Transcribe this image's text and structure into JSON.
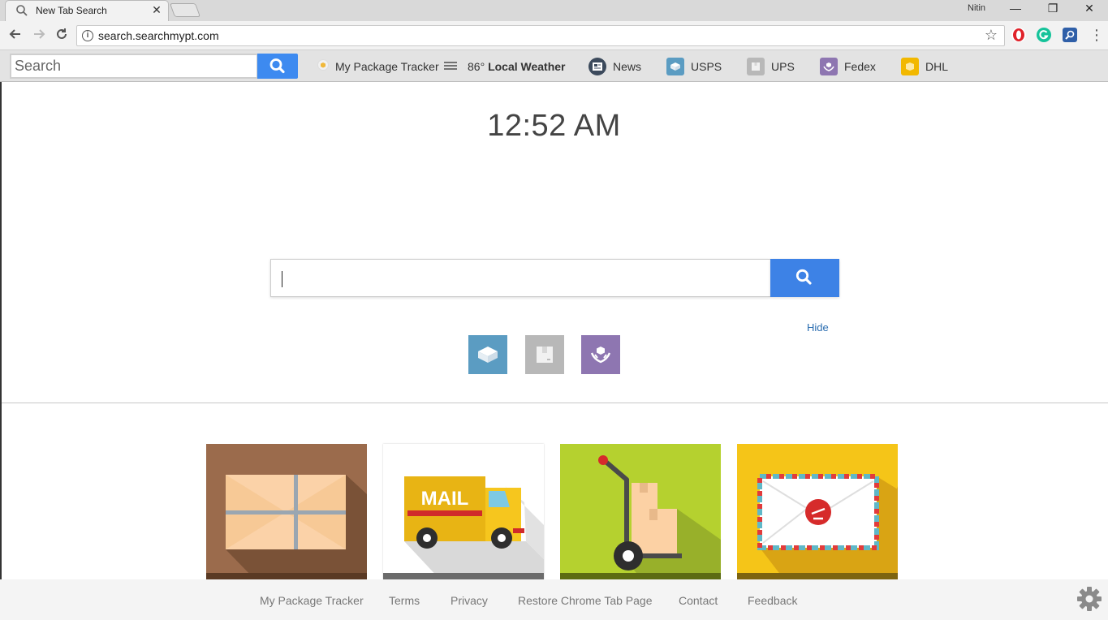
{
  "browser": {
    "tab_title": "New Tab Search",
    "tab_close": "✕",
    "profile_name": "Nitin",
    "window_buttons": {
      "minimize": "—",
      "restore": "❐",
      "close": "✕"
    },
    "url": "search.searchmypt.com"
  },
  "extension_bar": {
    "search_placeholder": "Search",
    "links": {
      "package_tracker": "My Package Tracker",
      "temperature": "86°",
      "weather": "Local Weather",
      "news": "News",
      "usps": "USPS",
      "ups": "UPS",
      "fedex": "Fedex",
      "dhl": "DHL"
    }
  },
  "main": {
    "clock": "12:52 AM",
    "search_value": "",
    "hide_label": "Hide",
    "quick_links": [
      "usps",
      "ups",
      "fedex"
    ],
    "tiles": [
      {
        "name": "package",
        "color": "#9b6b4c"
      },
      {
        "name": "mail-truck",
        "color": "#ffffff",
        "label": "MAIL"
      },
      {
        "name": "hand-truck",
        "color": "#b5d12f"
      },
      {
        "name": "envelope",
        "color": "#f5c518"
      }
    ]
  },
  "footer": {
    "links": {
      "package_tracker": "My Package Tracker",
      "terms": "Terms",
      "privacy": "Privacy",
      "restore": "Restore Chrome Tab Page",
      "contact": "Contact",
      "feedback": "Feedback"
    }
  },
  "colors": {
    "search_blue": "#3d82e6",
    "usps": "#5b9cc2",
    "ups": "#b8b8b8",
    "fedex": "#8e76b1",
    "dhl": "#f2b800"
  }
}
